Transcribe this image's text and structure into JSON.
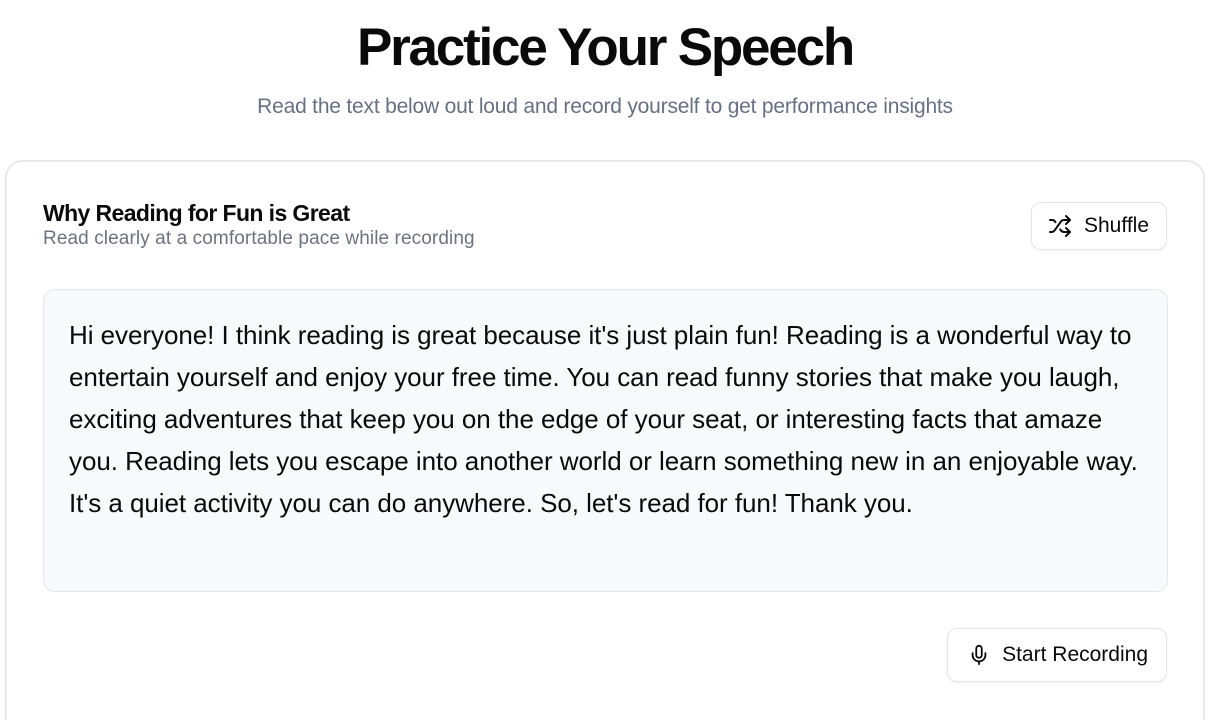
{
  "header": {
    "title": "Practice Your Speech",
    "subtitle": "Read the text below out loud and record yourself to get performance insights"
  },
  "card": {
    "title": "Why Reading for Fun is Great",
    "description": "Read clearly at a comfortable pace while recording",
    "shuffle_label": "Shuffle",
    "shuffle_icon": "shuffle-icon",
    "passage": "Hi everyone! I think reading is great because it's just plain fun! Reading is a wonderful way to entertain yourself and enjoy your free time. You can read funny stories that make you laugh, exciting adventures that keep you on the edge of your seat, or interesting facts that amaze you. Reading lets you escape into another world or learn something new in an enjoyable way. It's a quiet activity you can do anywhere. So, let's read for fun! Thank you.",
    "record_label": "Start Recording",
    "record_icon": "microphone-icon"
  },
  "colors": {
    "text": "#0a0a0a",
    "muted": "#6b7280",
    "border": "#e4e6eb",
    "passage_bg": "#f8f9fb"
  }
}
